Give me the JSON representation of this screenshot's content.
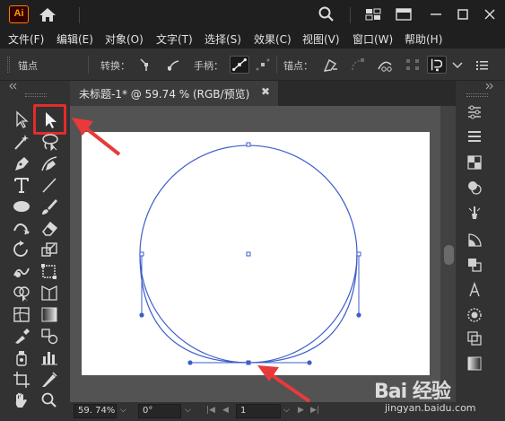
{
  "app": {
    "logo_text": "Ai",
    "accent": "#ff9a00"
  },
  "menu": {
    "items": [
      "文件(F)",
      "编辑(E)",
      "对象(O)",
      "文字(T)",
      "选择(S)",
      "效果(C)",
      "视图(V)",
      "窗口(W)",
      "帮助(H)"
    ]
  },
  "control_bar": {
    "anchor_label": "锚点",
    "convert_label": "转换：",
    "handle_label": "手柄：",
    "anchor_points_label": "锚点："
  },
  "document": {
    "tab_title": "未标题-1* @ 59.74 % (RGB/预览)",
    "close_glyph": "✖"
  },
  "status": {
    "zoom": "59. 74%",
    "rotation": "0°",
    "artboard_number": "1"
  },
  "annotations": {
    "highlight_color": "#e52b2b"
  },
  "watermark": {
    "logo": "Bai 经验",
    "url": "jingyan.baidu.com"
  },
  "colors": {
    "path_stroke": "#3d5ec9",
    "anchor_fill": "#ffffff",
    "arrow": "#e83a3a"
  }
}
